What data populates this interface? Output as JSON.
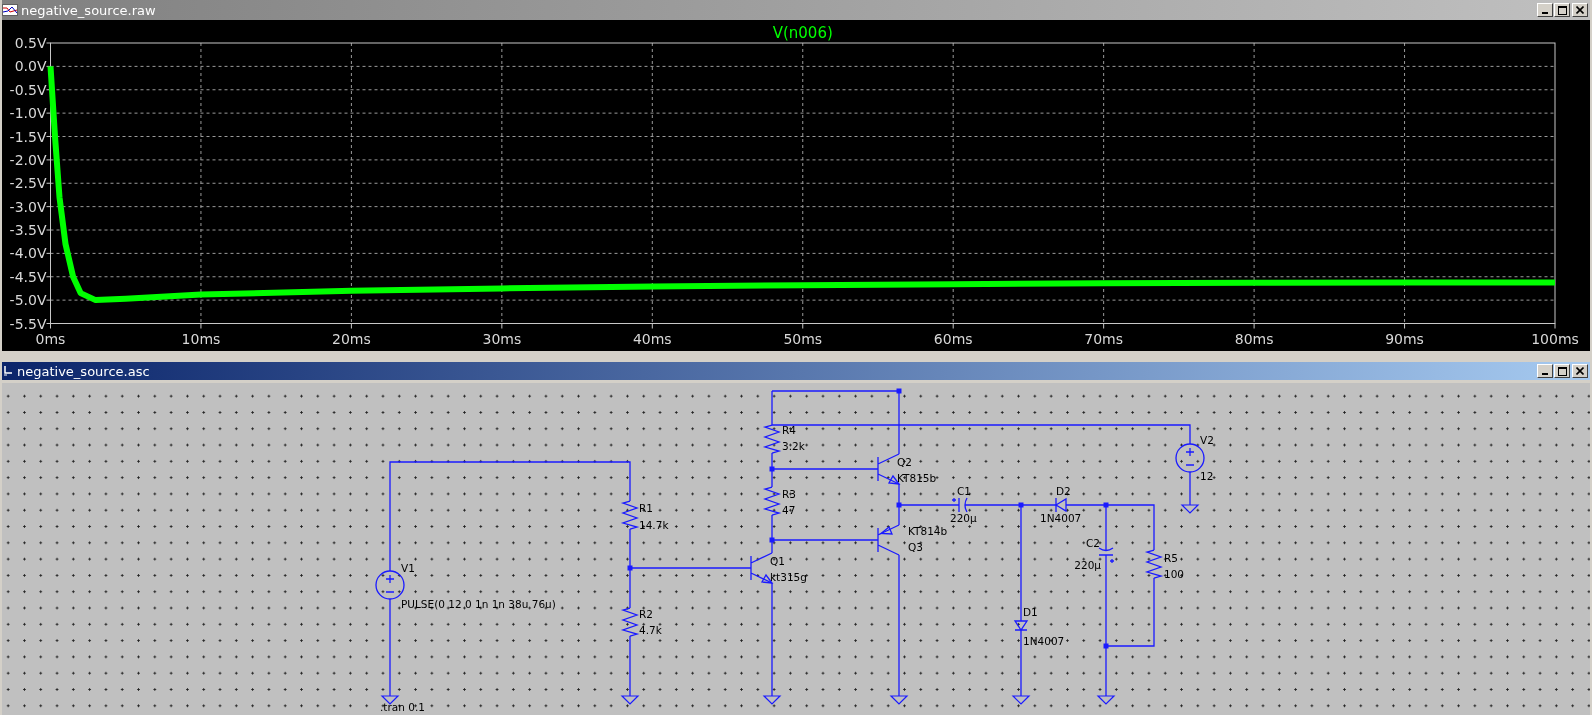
{
  "windows": [
    {
      "title": "negative_source.raw",
      "active": false,
      "kind": "waveform",
      "chart_data": {
        "type": "line",
        "grid": true,
        "x": [
          0,
          0.3,
          0.6,
          1,
          1.5,
          2,
          3,
          5,
          10,
          20,
          30,
          40,
          50,
          60,
          70,
          80,
          90,
          100
        ],
        "series": [
          {
            "name": "V(n006)",
            "color": "#00ff00",
            "values": [
              0,
              -1.5,
              -2.8,
              -3.8,
              -4.5,
              -4.85,
              -5.0,
              -4.97,
              -4.88,
              -4.8,
              -4.75,
              -4.71,
              -4.68,
              -4.66,
              -4.64,
              -4.63,
              -4.62,
              -4.62
            ]
          }
        ],
        "xlim": [
          0,
          100
        ],
        "ylim": [
          -5.5,
          0.5
        ],
        "xticks": [
          {
            "value": 0,
            "label": "0ms"
          },
          {
            "value": 10,
            "label": "10ms"
          },
          {
            "value": 20,
            "label": "20ms"
          },
          {
            "value": 30,
            "label": "30ms"
          },
          {
            "value": 40,
            "label": "40ms"
          },
          {
            "value": 50,
            "label": "50ms"
          },
          {
            "value": 60,
            "label": "60ms"
          },
          {
            "value": 70,
            "label": "70ms"
          },
          {
            "value": 80,
            "label": "80ms"
          },
          {
            "value": 90,
            "label": "90ms"
          },
          {
            "value": 100,
            "label": "100ms"
          }
        ],
        "yticks": [
          {
            "value": 0.5,
            "label": "0.5V"
          },
          {
            "value": 0,
            "label": "0.0V"
          },
          {
            "value": -0.5,
            "label": "-0.5V"
          },
          {
            "value": -1,
            "label": "-1.0V"
          },
          {
            "value": -1.5,
            "label": "-1.5V"
          },
          {
            "value": -2,
            "label": "-2.0V"
          },
          {
            "value": -2.5,
            "label": "-2.5V"
          },
          {
            "value": -3,
            "label": "-3.0V"
          },
          {
            "value": -3.5,
            "label": "-3.5V"
          },
          {
            "value": -4,
            "label": "-4.0V"
          },
          {
            "value": -4.5,
            "label": "-4.5V"
          },
          {
            "value": -5,
            "label": "-5.0V"
          },
          {
            "value": -5.5,
            "label": "-5.5V"
          }
        ]
      }
    },
    {
      "title": "negative_source.asc",
      "active": true,
      "kind": "schematic",
      "components": [
        {
          "kind": "resistor",
          "designator": "R4",
          "value": "3.2k"
        },
        {
          "kind": "voltage_source",
          "designator": "V2",
          "value": "12"
        },
        {
          "kind": "npn",
          "designator": "Q2",
          "value": "KT815b"
        },
        {
          "kind": "resistor",
          "designator": "R3",
          "value": "47"
        },
        {
          "kind": "capacitor",
          "designator": "C1",
          "value": "220µ"
        },
        {
          "kind": "diode",
          "designator": "D2",
          "value": "1N4007"
        },
        {
          "kind": "resistor",
          "designator": "R1",
          "value": "14.7k"
        },
        {
          "kind": "pnp",
          "designator": "Q3",
          "value": "KT814b"
        },
        {
          "kind": "capacitor",
          "designator": "C2",
          "value": "220µ"
        },
        {
          "kind": "resistor",
          "designator": "R5",
          "value": "100"
        },
        {
          "kind": "npn",
          "designator": "Q1",
          "value": "kt315g"
        },
        {
          "kind": "voltage_source",
          "designator": "V1",
          "value": "PULSE(0 12 0 1n 1n 38u 76u)"
        },
        {
          "kind": "resistor",
          "designator": "R2",
          "value": "4.7k"
        },
        {
          "kind": "diode",
          "designator": "D1",
          "value": "1N4007"
        }
      ],
      "directives": [
        ".tran 0.1"
      ]
    }
  ]
}
